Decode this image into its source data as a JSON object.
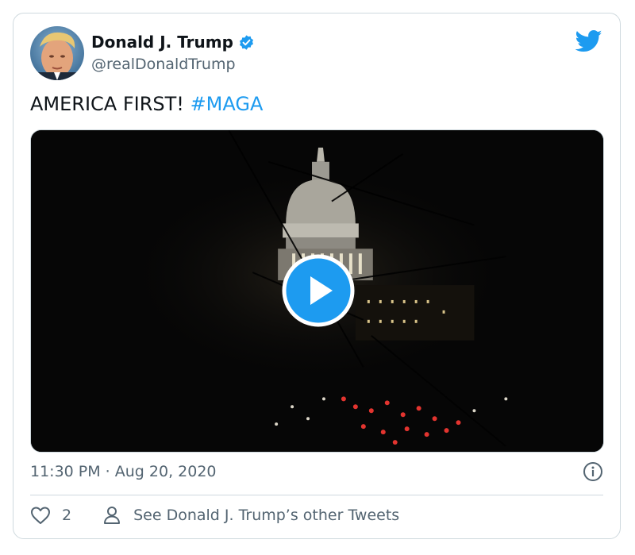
{
  "author": {
    "name": "Donald J. Trump",
    "handle": "@realDonaldTrump",
    "verified": true
  },
  "tweet": {
    "text": "AMERICA FIRST! ",
    "hashtag": "#MAGA"
  },
  "media": {
    "type": "video",
    "control_icon": "play-icon"
  },
  "meta": {
    "timestamp": "11:30 PM · Aug 20, 2020"
  },
  "actions": {
    "like_count": "2",
    "other_tweets_label": "See Donald J. Trump’s other Tweets"
  },
  "colors": {
    "accent": "#1d9bf0",
    "text_secondary": "#536471",
    "border": "#cfd9de"
  }
}
